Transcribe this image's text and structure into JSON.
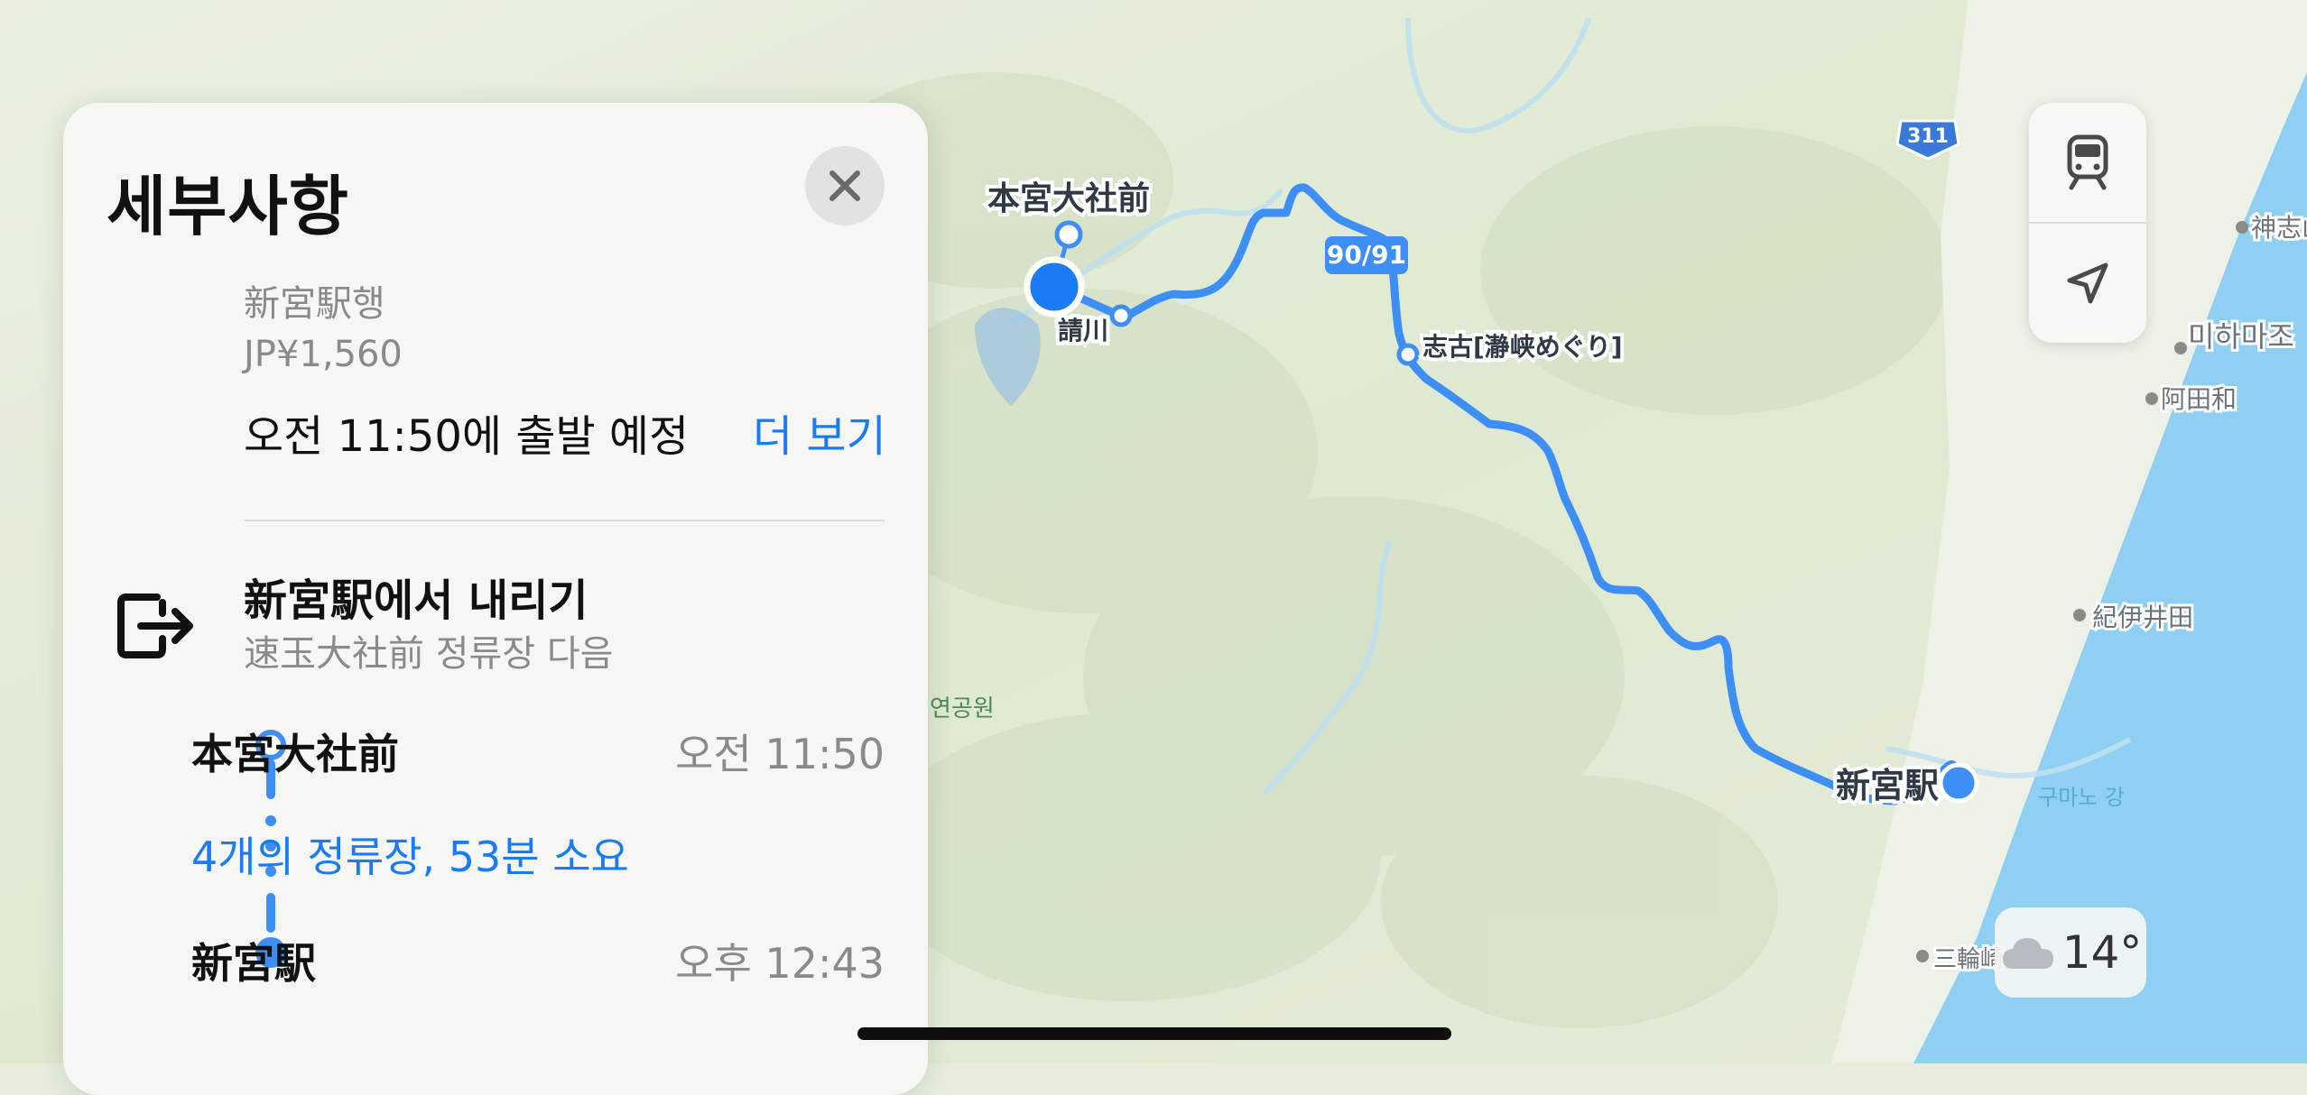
{
  "panel": {
    "title": "세부사항",
    "close_icon": "close-icon",
    "destination": "新宮駅행",
    "fare": "JP¥1,560",
    "departure": "오전 11:50에 출발 예정",
    "more_label": "더 보기",
    "alight_title": "新宮駅에서 내리기",
    "alight_sub": "速玉大社前 정류장 다음",
    "exit_icon": "exit-icon",
    "trip": {
      "from_stop": "本宮大社前",
      "from_time": "오전 11:50",
      "stops_summary": "4개의 정류장, 53분 소요",
      "to_stop": "新宮駅",
      "to_time": "오후 12:43"
    }
  },
  "map": {
    "labels": {
      "hongu": "本宮大社前",
      "ukegawa": "請川",
      "route_badge": "90/91",
      "shiko": "志古[瀞峡めぐり]",
      "shingu": "新宮駅",
      "road_311": "311",
      "kamishiki": "神志山",
      "mihamazo": "미하마조",
      "atawa": "阿田和",
      "kiiida": "紀伊井田",
      "kumano_river": "구마노 강",
      "miwasaki": "三輪崎",
      "park": "연공원"
    },
    "colors": {
      "route": "#3d8ef5",
      "sea": "#8fd0f2",
      "terrain": "#dfe9d2"
    }
  },
  "controls": {
    "transit_icon": "train-icon",
    "location_icon": "location-arrow-icon"
  },
  "weather": {
    "icon": "cloud-icon",
    "temperature": "14°"
  }
}
